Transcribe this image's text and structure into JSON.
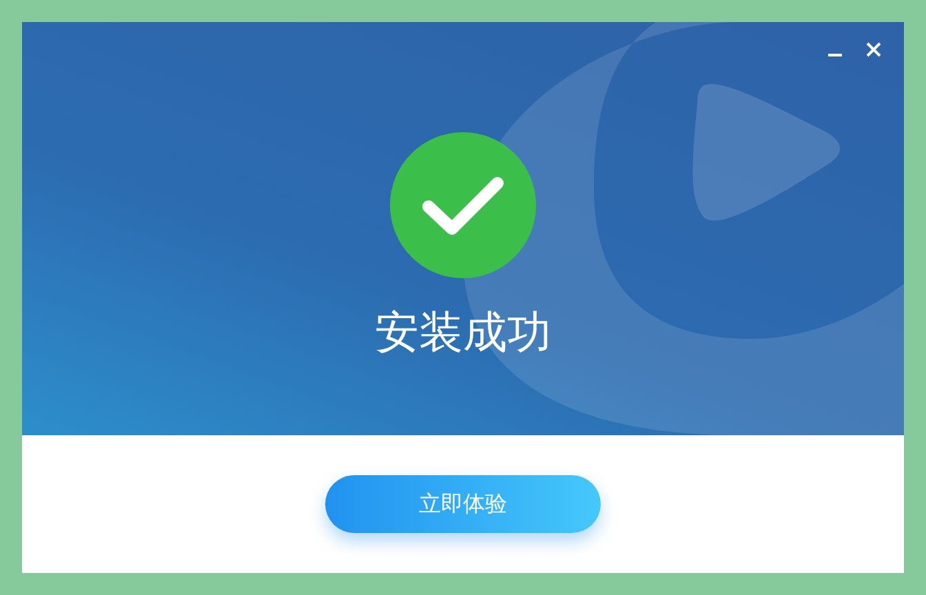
{
  "window": {
    "controls": [
      {
        "kind": "minimize"
      },
      {
        "kind": "close"
      }
    ]
  },
  "status": {
    "kind": "success",
    "message": "安装成功"
  },
  "primary_button": {
    "label": "立即体验"
  }
}
